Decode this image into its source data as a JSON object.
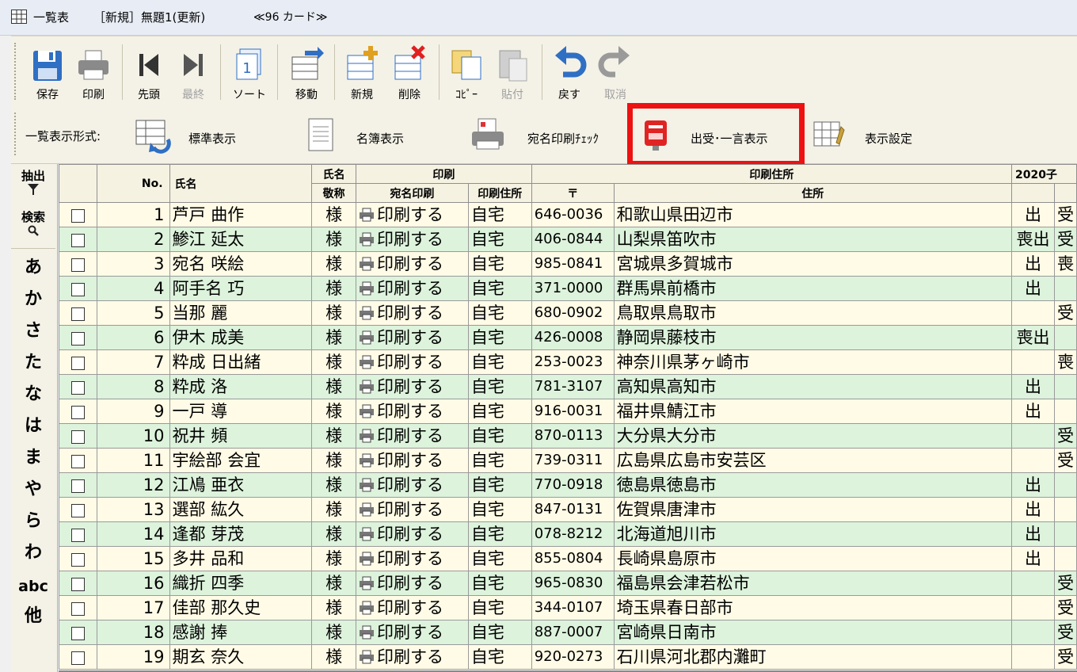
{
  "window": {
    "title_main": "一覧表",
    "title_doc": "［新規］無題1(更新)",
    "title_count": "≪96 カード≫"
  },
  "toolbar": [
    {
      "id": "save",
      "label": "保存",
      "icon": "floppy-disk-icon",
      "enabled": true
    },
    {
      "id": "print",
      "label": "印刷",
      "icon": "printer-icon",
      "enabled": true
    },
    {
      "id": "first",
      "label": "先頭",
      "icon": "skip-first-icon",
      "enabled": true
    },
    {
      "id": "last",
      "label": "最終",
      "icon": "skip-last-icon",
      "enabled": false
    },
    {
      "id": "sort",
      "label": "ソート",
      "icon": "sort-icon",
      "enabled": true
    },
    {
      "id": "move",
      "label": "移動",
      "icon": "move-record-icon",
      "enabled": true
    },
    {
      "id": "new",
      "label": "新規",
      "icon": "new-record-icon",
      "enabled": true
    },
    {
      "id": "delete",
      "label": "削除",
      "icon": "delete-record-icon",
      "enabled": true
    },
    {
      "id": "copy",
      "label": "ｺﾋﾟｰ",
      "icon": "copy-icon",
      "enabled": true
    },
    {
      "id": "paste",
      "label": "貼付",
      "icon": "paste-icon",
      "enabled": false
    },
    {
      "id": "undo",
      "label": "戻す",
      "icon": "undo-icon",
      "enabled": true
    },
    {
      "id": "redo",
      "label": "取消",
      "icon": "redo-icon",
      "enabled": false
    }
  ],
  "view_bar": {
    "label": "一覧表示形式:",
    "buttons": [
      {
        "id": "standard",
        "label": "標準表示",
        "icon": "standard-view-icon"
      },
      {
        "id": "directory",
        "label": "名簿表示",
        "icon": "directory-view-icon"
      },
      {
        "id": "print_check",
        "label": "宛名印刷ﾁｪｯｸ",
        "icon": "print-check-icon"
      },
      {
        "id": "mail_note",
        "label": "出受･一言表示",
        "icon": "postbox-icon",
        "highlighted": true
      },
      {
        "id": "settings",
        "label": "表示設定",
        "icon": "display-settings-icon"
      }
    ]
  },
  "sidebar": {
    "extract": "抽出",
    "search": "検索",
    "index": [
      "あ",
      "か",
      "さ",
      "た",
      "な",
      "は",
      "ま",
      "や",
      "ら",
      "わ",
      "abc",
      "他"
    ]
  },
  "grid": {
    "headers_top": {
      "no": "No.",
      "name": "氏名",
      "name_group": "氏名",
      "print_group": "印刷",
      "print_address_group": "印刷住所",
      "year_group": "2020子"
    },
    "headers_bottom": {
      "title": "敬称",
      "print_label": "宛名印刷",
      "print_addr": "印刷住所",
      "zip": "〒",
      "address": "住所"
    },
    "rows": [
      {
        "no": "1",
        "name": "芦戸 曲作",
        "title": "様",
        "print": "印刷する",
        "addr_type": "自宅",
        "zip": "646-0036",
        "address": "和歌山県田辺市",
        "sent": "出",
        "recv": "受"
      },
      {
        "no": "2",
        "name": "鯵江 延太",
        "title": "様",
        "print": "印刷する",
        "addr_type": "自宅",
        "zip": "406-0844",
        "address": "山梨県笛吹市",
        "sent": "喪出",
        "recv": "受"
      },
      {
        "no": "3",
        "name": "宛名 咲絵",
        "title": "様",
        "print": "印刷する",
        "addr_type": "自宅",
        "zip": "985-0841",
        "address": "宮城県多賀城市",
        "sent": "出",
        "recv": "喪"
      },
      {
        "no": "4",
        "name": "阿手名 巧",
        "title": "様",
        "print": "印刷する",
        "addr_type": "自宅",
        "zip": "371-0000",
        "address": "群馬県前橋市",
        "sent": "出",
        "recv": ""
      },
      {
        "no": "5",
        "name": "当那 麗",
        "title": "様",
        "print": "印刷する",
        "addr_type": "自宅",
        "zip": "680-0902",
        "address": "鳥取県鳥取市",
        "sent": "",
        "recv": "受"
      },
      {
        "no": "6",
        "name": "伊木 成美",
        "title": "様",
        "print": "印刷する",
        "addr_type": "自宅",
        "zip": "426-0008",
        "address": "静岡県藤枝市",
        "sent": "喪出",
        "recv": ""
      },
      {
        "no": "7",
        "name": "粋成 日出緒",
        "title": "様",
        "print": "印刷する",
        "addr_type": "自宅",
        "zip": "253-0023",
        "address": "神奈川県茅ヶ崎市",
        "sent": "",
        "recv": "喪"
      },
      {
        "no": "8",
        "name": "粋成 洛",
        "title": "様",
        "print": "印刷する",
        "addr_type": "自宅",
        "zip": "781-3107",
        "address": "高知県高知市",
        "sent": "出",
        "recv": ""
      },
      {
        "no": "9",
        "name": "一戸 導",
        "title": "様",
        "print": "印刷する",
        "addr_type": "自宅",
        "zip": "916-0031",
        "address": "福井県鯖江市",
        "sent": "出",
        "recv": ""
      },
      {
        "no": "10",
        "name": "祝井 頻",
        "title": "様",
        "print": "印刷する",
        "addr_type": "自宅",
        "zip": "870-0113",
        "address": "大分県大分市",
        "sent": "",
        "recv": "受"
      },
      {
        "no": "11",
        "name": "宇絵部 会宜",
        "title": "様",
        "print": "印刷する",
        "addr_type": "自宅",
        "zip": "739-0311",
        "address": "広島県広島市安芸区",
        "sent": "",
        "recv": "受"
      },
      {
        "no": "12",
        "name": "江鳰 亜衣",
        "title": "様",
        "print": "印刷する",
        "addr_type": "自宅",
        "zip": "770-0918",
        "address": "徳島県徳島市",
        "sent": "出",
        "recv": ""
      },
      {
        "no": "13",
        "name": "選部 紘久",
        "title": "様",
        "print": "印刷する",
        "addr_type": "自宅",
        "zip": "847-0131",
        "address": "佐賀県唐津市",
        "sent": "出",
        "recv": ""
      },
      {
        "no": "14",
        "name": "逢都 芽茂",
        "title": "様",
        "print": "印刷する",
        "addr_type": "自宅",
        "zip": "078-8212",
        "address": "北海道旭川市",
        "sent": "出",
        "recv": ""
      },
      {
        "no": "15",
        "name": "多井 品和",
        "title": "様",
        "print": "印刷する",
        "addr_type": "自宅",
        "zip": "855-0804",
        "address": "長崎県島原市",
        "sent": "出",
        "recv": ""
      },
      {
        "no": "16",
        "name": "織折 四季",
        "title": "様",
        "print": "印刷する",
        "addr_type": "自宅",
        "zip": "965-0830",
        "address": "福島県会津若松市",
        "sent": "",
        "recv": "受"
      },
      {
        "no": "17",
        "name": "佳部 那久史",
        "title": "様",
        "print": "印刷する",
        "addr_type": "自宅",
        "zip": "344-0107",
        "address": "埼玉県春日部市",
        "sent": "",
        "recv": "受"
      },
      {
        "no": "18",
        "name": "感謝 捧",
        "title": "様",
        "print": "印刷する",
        "addr_type": "自宅",
        "zip": "887-0007",
        "address": "宮崎県日南市",
        "sent": "",
        "recv": "受"
      },
      {
        "no": "19",
        "name": "期玄 奈久",
        "title": "様",
        "print": "印刷する",
        "addr_type": "自宅",
        "zip": "920-0273",
        "address": "石川県河北郡内灘町",
        "sent": "",
        "recv": "受"
      }
    ]
  },
  "colors": {
    "row_odd": "#fffbe6",
    "row_even": "#ddf3dc",
    "highlight": "#ee1111",
    "toolbar_bg": "#f4f2e7"
  }
}
